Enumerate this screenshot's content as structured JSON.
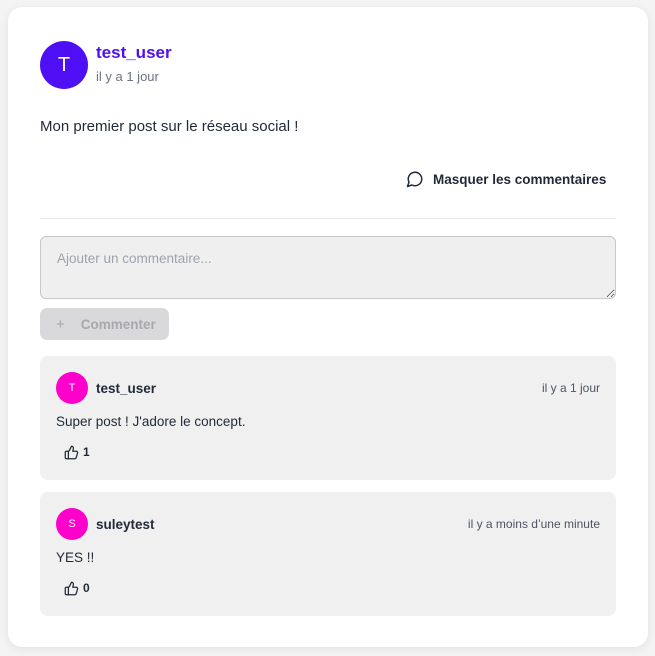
{
  "post": {
    "author_initial": "T",
    "author": "test_user",
    "time": "il y a 1 jour",
    "content": "Mon premier post sur le réseau social !",
    "toggle_comments_label": "Masquer les commentaires"
  },
  "comment_form": {
    "placeholder": "Ajouter un commentaire...",
    "value": "",
    "submit_label": "Commenter",
    "submit_icon": "plus-icon"
  },
  "comments": [
    {
      "initial": "T",
      "author": "test_user",
      "time": "il y a 1 jour",
      "text": "Super post ! J'adore le concept.",
      "likes": "1"
    },
    {
      "initial": "S",
      "author": "suleytest",
      "time": "il y a moins d’une minute",
      "text": "YES !!",
      "likes": "0"
    }
  ],
  "colors": {
    "brand": "#4f0ff5",
    "comment_avatar": "#ff00cc",
    "comment_bg": "#f0f0f0",
    "disabled_button": "#d9d9dc"
  },
  "icons": {
    "toggle": "comment-bubble-icon",
    "like": "thumbs-up-icon"
  }
}
